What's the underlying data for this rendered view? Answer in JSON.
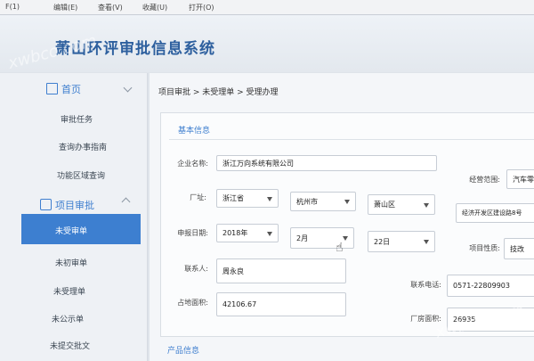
{
  "menubar": {
    "items": [
      "F(1)",
      "编辑(E)",
      "查看(V)",
      "收藏(U)",
      "打开(O)"
    ]
  },
  "app": {
    "title": "萧山环评审批信息系统"
  },
  "sidebar": {
    "home": "首页",
    "home_items": [
      "审批任务",
      "查询办事指南",
      "功能区域查询"
    ],
    "group": "项目审批",
    "group_items": [
      "未受审单",
      "未初审单",
      "未受理单",
      "未公示单",
      "未提交批文"
    ],
    "active_index": 0
  },
  "breadcrumb": "项目审批 > 未受理单 > 受理办理",
  "basic": {
    "title": "基本信息",
    "company_label": "企业名称:",
    "company_value": "浙江万向系统有限公司",
    "scope_label": "经营范围:",
    "scope_value": "汽车零",
    "address_label": "厂址:",
    "province": "浙江省",
    "city": "杭州市",
    "district": "萧山区",
    "zone_value": "经济开发区建设路8号",
    "date_label": "申报日期:",
    "year": "2018年",
    "month": "2月",
    "day": "22日",
    "nature_label": "项目性质:",
    "nature_value": "技改",
    "contact_label": "联系人:",
    "contact_value": "周永良",
    "phone_label": "联系电话:",
    "phone_value": "0571-22809903",
    "area_label": "占地面积:",
    "area_value": "42106.67",
    "factory_area_label": "厂房面积:",
    "factory_area_value": "26935"
  },
  "product": {
    "title": "产品信息"
  },
  "watermark": "xwbco.com"
}
